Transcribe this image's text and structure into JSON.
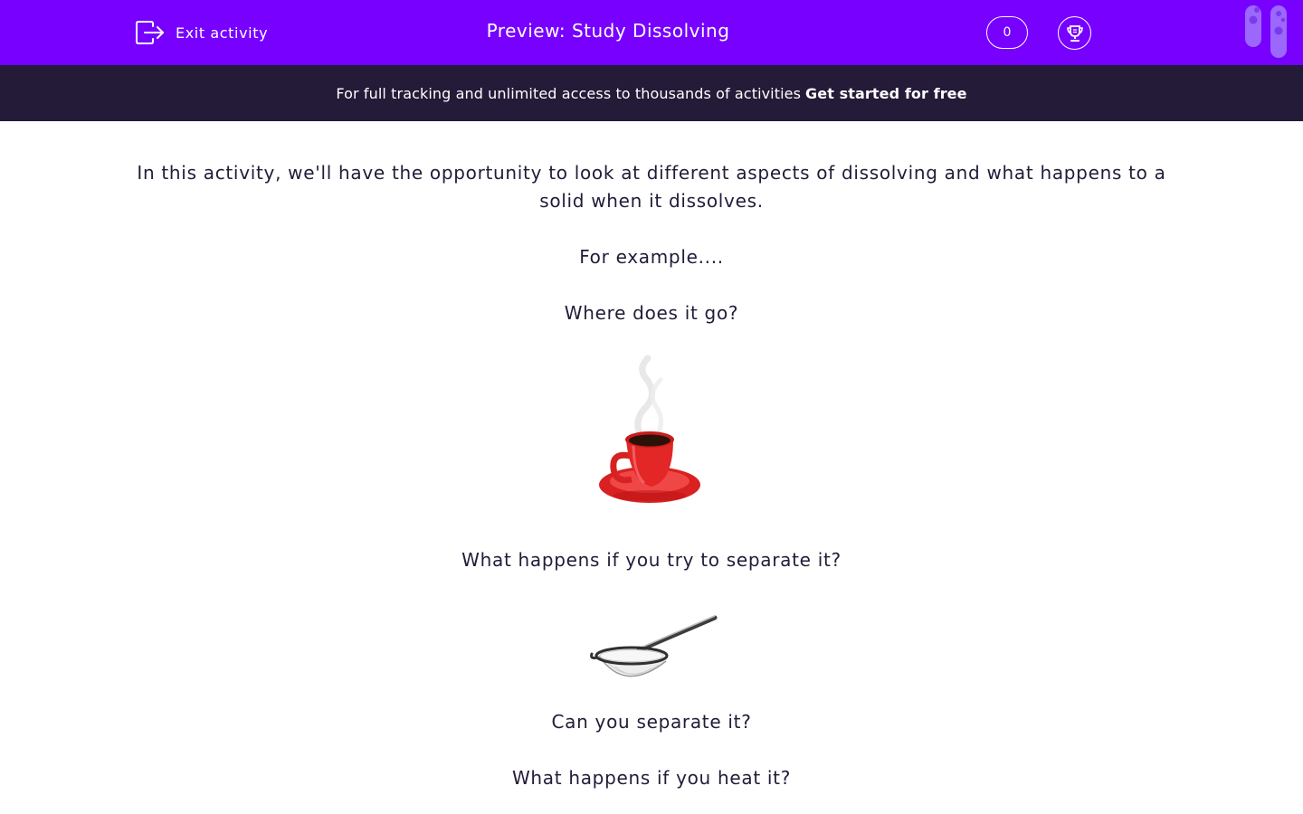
{
  "header": {
    "exit_label": "Exit activity",
    "title": "Preview: Study Dissolving",
    "score": "0",
    "accent": "#7700ff"
  },
  "banner": {
    "text": "For full tracking and unlimited access to thousands of activities",
    "cta": "Get started for free",
    "background": "#231b38"
  },
  "content": {
    "intro": "In this activity, we'll have the opportunity to look at different aspects of dissolving and what happens to a solid when it dissolves.",
    "example": "For example....",
    "q1": "Where does it go?",
    "q2": "What happens if you try to separate it?",
    "q3": "Can you separate it?",
    "q4": "What happens if you heat it?",
    "image1": "red-coffee-cup-photo",
    "image2": "tea-strainer-photo"
  }
}
